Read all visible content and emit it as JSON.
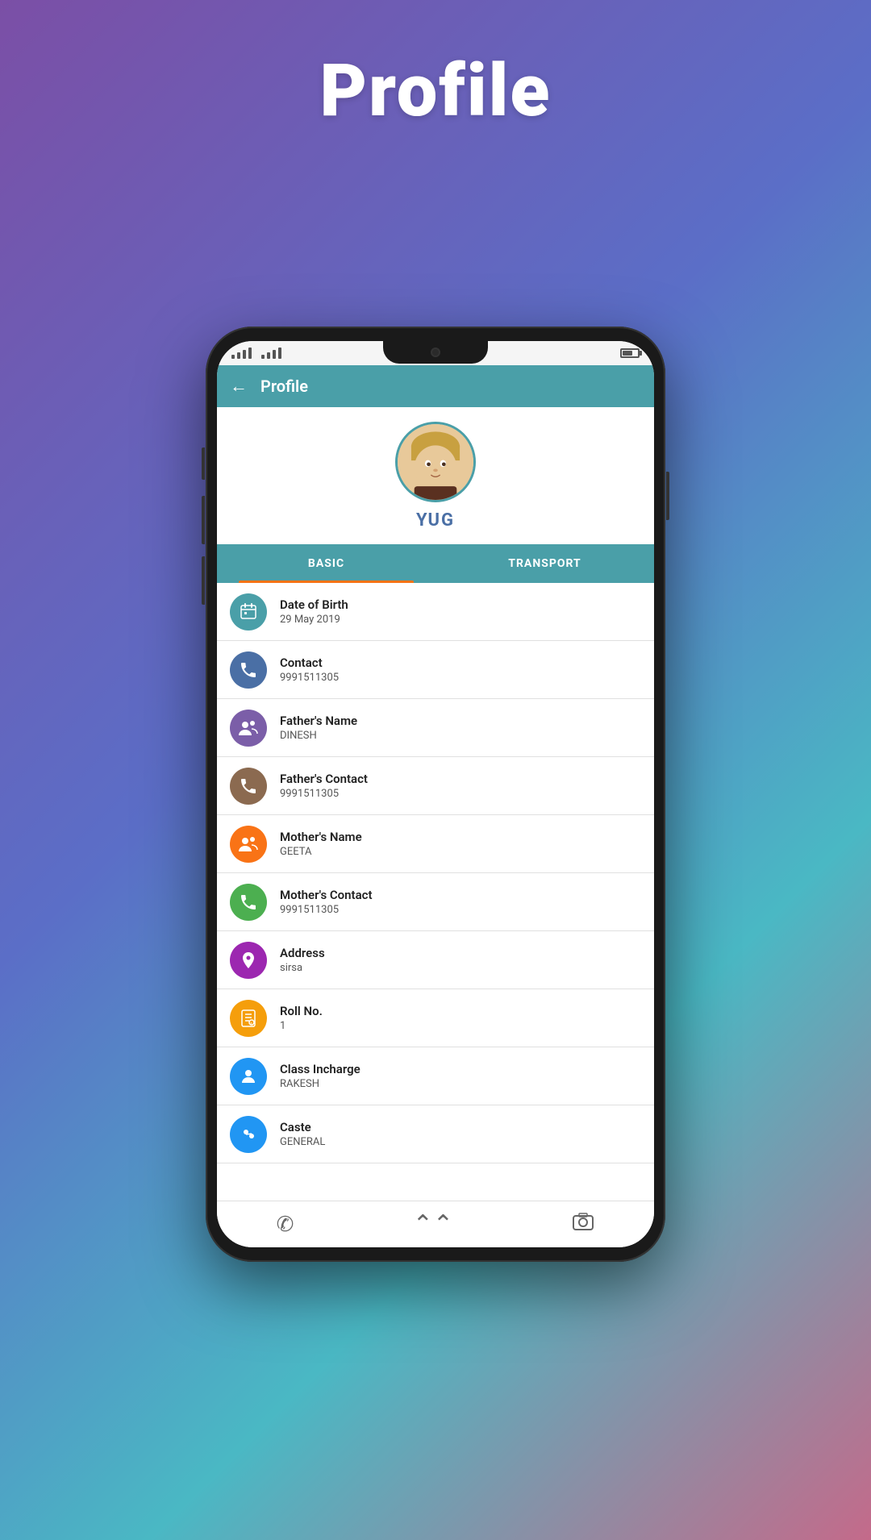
{
  "page": {
    "title": "Profile"
  },
  "header": {
    "back_label": "←",
    "title": "Profile"
  },
  "student": {
    "name": "YUG"
  },
  "tabs": [
    {
      "id": "basic",
      "label": "BASIC",
      "active": true
    },
    {
      "id": "transport",
      "label": "TRANSPORT",
      "active": false
    }
  ],
  "profile_items": [
    {
      "id": "dob",
      "label": "Date of Birth",
      "value": "29 May 2019",
      "icon_color": "#4a9fa8",
      "icon": "📅"
    },
    {
      "id": "contact",
      "label": "Contact",
      "value": "9991511305",
      "icon_color": "#4a6fa5",
      "icon": "📞"
    },
    {
      "id": "fathers_name",
      "label": "Father's Name",
      "value": "DINESH",
      "icon_color": "#7b5ea8",
      "icon": "👨‍👦"
    },
    {
      "id": "fathers_contact",
      "label": "Father's Contact",
      "value": "9991511305",
      "icon_color": "#8b6a50",
      "icon": "📞"
    },
    {
      "id": "mothers_name",
      "label": "Mother's Name",
      "value": "GEETA",
      "icon_color": "#f97316",
      "icon": "👩‍👦"
    },
    {
      "id": "mothers_contact",
      "label": "Mother's Contact",
      "value": "9991511305",
      "icon_color": "#4caf50",
      "icon": "📞"
    },
    {
      "id": "address",
      "label": "Address",
      "value": "sirsa",
      "icon_color": "#9c27b0",
      "icon": "🏠"
    },
    {
      "id": "roll_no",
      "label": "Roll No.",
      "value": "1",
      "icon_color": "#f59e0b",
      "icon": "🪪"
    },
    {
      "id": "class_incharge",
      "label": "Class Incharge",
      "value": "RAKESH",
      "icon_color": "#2196f3",
      "icon": "👤"
    },
    {
      "id": "caste",
      "label": "Caste",
      "value": "GENERAL",
      "icon_color": "#2196f3",
      "icon": "🔣"
    }
  ],
  "bottom_nav": {
    "phone_icon": "✆",
    "up_icon": "⌃",
    "camera_icon": "⊙"
  }
}
